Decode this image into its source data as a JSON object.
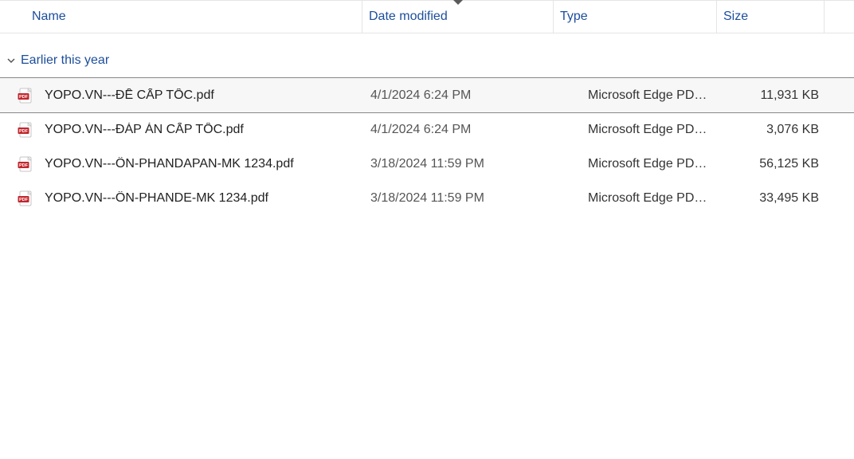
{
  "columns": {
    "name": "Name",
    "date": "Date modified",
    "type": "Type",
    "size": "Size"
  },
  "sort_column": "date",
  "sort_direction": "desc",
  "group": {
    "label": "Earlier this year"
  },
  "files": [
    {
      "name": "YOPO.VN---ĐỀ CẤP TỐC.pdf",
      "date": "4/1/2024 6:24 PM",
      "type": "Microsoft Edge PDF ...",
      "size": "11,931 KB",
      "selected": true
    },
    {
      "name": "YOPO.VN---ĐÁP ÁN CẤP TỐC.pdf",
      "date": "4/1/2024 6:24 PM",
      "type": "Microsoft Edge PDF ...",
      "size": "3,076 KB",
      "selected": false
    },
    {
      "name": "YOPO.VN---ÔN-PHANDAPAN-MK 1234.pdf",
      "date": "3/18/2024 11:59 PM",
      "type": "Microsoft Edge PDF ...",
      "size": "56,125 KB",
      "selected": false
    },
    {
      "name": "YOPO.VN---ÔN-PHANDE-MK 1234.pdf",
      "date": "3/18/2024 11:59 PM",
      "type": "Microsoft Edge PDF ...",
      "size": "33,495 KB",
      "selected": false
    }
  ]
}
